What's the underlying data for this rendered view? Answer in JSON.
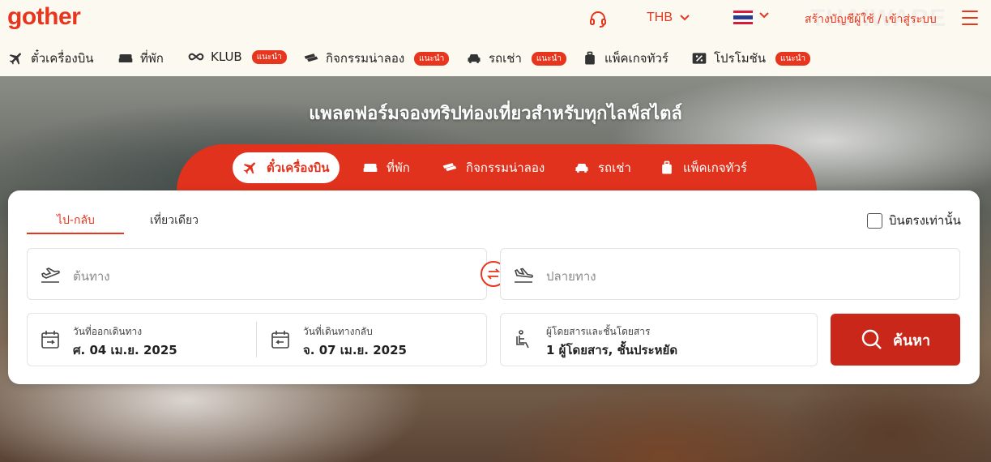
{
  "header": {
    "logo": "gother",
    "currency": "THB",
    "auth_link": "สร้างบัญชีผู้ใช้ / เข้าสู่ระบบ",
    "watermark": "THAIWARE",
    "icons": [
      "headset-icon",
      "chevron-down-icon",
      "thai-flag-icon",
      "hamburger-menu-icon"
    ],
    "flag_colors": [
      "#d81b3b",
      "#ffffff",
      "#2b3b8f",
      "#ffffff",
      "#d81b3b"
    ]
  },
  "subnav": {
    "items": [
      {
        "label": "ตั๋วเครื่องบิน",
        "icon": "plane-icon",
        "badge": ""
      },
      {
        "label": "ที่พัก",
        "icon": "bed-icon",
        "badge": ""
      },
      {
        "label": "KLUB",
        "icon": "infinity-icon",
        "badge": "แนะนำ"
      },
      {
        "label": "กิจกรรมน่าลอง",
        "icon": "ticket-icon",
        "badge": "แนะนำ"
      },
      {
        "label": "รถเช่า",
        "icon": "car-icon",
        "badge": "แนะนำ"
      },
      {
        "label": "แพ็คเกจทัวร์",
        "icon": "suitcase-icon",
        "badge": ""
      },
      {
        "label": "โปรโมชัน",
        "icon": "percent-icon",
        "badge": "แนะนำ"
      }
    ]
  },
  "hero": {
    "title": "แพลตฟอร์มจองทริปท่องเที่ยวสำหรับทุกไลฟ์สไตล์",
    "tabs": [
      {
        "label": "ตั๋วเครื่องบิน",
        "icon": "plane-icon",
        "active": true
      },
      {
        "label": "ที่พัก",
        "icon": "bed-icon",
        "active": false
      },
      {
        "label": "กิจกรรมน่าลอง",
        "icon": "ticket-icon",
        "active": false
      },
      {
        "label": "รถเช่า",
        "icon": "car-icon",
        "active": false
      },
      {
        "label": "แพ็คเกจทัวร์",
        "icon": "suitcase-icon",
        "active": false
      }
    ]
  },
  "search": {
    "trip_types": [
      {
        "label": "ไป-กลับ",
        "active": true
      },
      {
        "label": "เที่ยวเดียว",
        "active": false
      }
    ],
    "direct_only_label": "บินตรงเท่านั้น",
    "origin_placeholder": "ต้นทาง",
    "destination_placeholder": "ปลายทาง",
    "depart_label": "วันที่ออกเดินทาง",
    "depart_value": "ศ. 04 เม.ย. 2025",
    "return_label": "วันที่เดินทางกลับ",
    "return_value": "จ. 07 เม.ย. 2025",
    "passenger_label": "ผู้โดยสารและชั้นโดยสาร",
    "passenger_value": "1 ผู้โดยสาร, ชั้นประหยัด",
    "search_label": "ค้นหา"
  },
  "colors": {
    "brand": "#e8361e",
    "hero_tab_bar": "#e0321c",
    "search_button": "#c9271a",
    "header_bg": "#fbf9f0"
  }
}
